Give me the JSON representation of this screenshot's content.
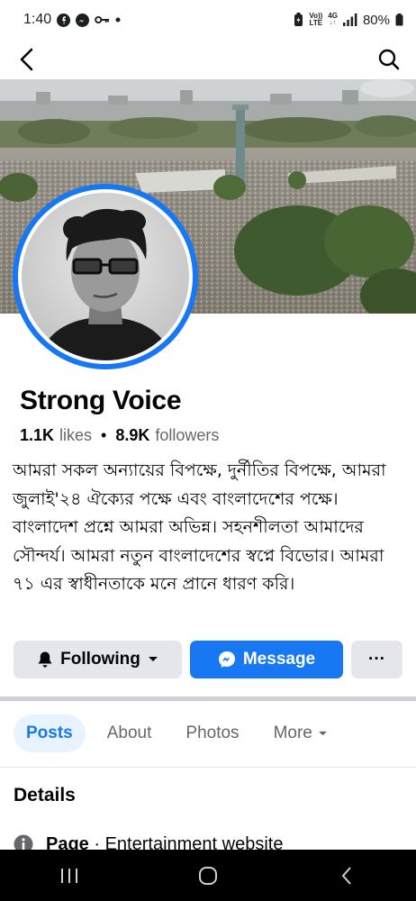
{
  "status_bar": {
    "time": "1:40",
    "network_top": "Vo))",
    "network_bottom": "LTE",
    "network_type": "4G",
    "battery": "80%"
  },
  "nav": {
    "back_icon": "back-arrow-icon",
    "search_icon": "search-icon"
  },
  "profile": {
    "name": "Strong Voice",
    "likes_count": "1.1K",
    "likes_label": "likes",
    "separator": "•",
    "followers_count": "8.9K",
    "followers_label": "followers",
    "bio": "আমরা সকল অন্যায়ের বিপক্ষে, দুর্নীতির বিপক্ষে, আমরা জুলাই'২৪ ঐক্যের পক্ষে এবং বাংলাদেশের পক্ষে। বাংলাদেশ প্রশ্নে আমরা অভিন্ন। সহনশীলতা আমাদের সৌন্দর্য। আমরা নতুন বাংলাদেশের স্বপ্নে বিভোর। আমরা ৭১ এর স্বাধীনতাকে মনে প্রানে ধারণ করি।"
  },
  "actions": {
    "following_label": "Following",
    "message_label": "Message",
    "more_label": "···"
  },
  "tabs": [
    {
      "label": "Posts",
      "active": true
    },
    {
      "label": "About",
      "active": false
    },
    {
      "label": "Photos",
      "active": false
    },
    {
      "label": "More",
      "active": false
    }
  ],
  "details": {
    "title": "Details",
    "row_label": "Page",
    "row_value": " · Entertainment website"
  },
  "colors": {
    "accent": "#1877f2",
    "button_gray": "#e4e6eb",
    "secondary_text": "#65676b"
  }
}
